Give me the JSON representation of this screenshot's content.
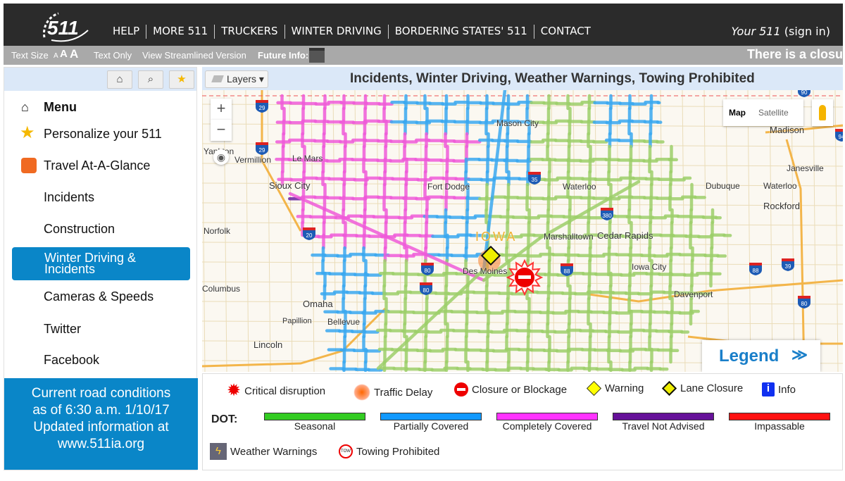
{
  "header": {
    "logo": "511",
    "nav": [
      "HELP",
      "MORE 511",
      "TRUCKERS",
      "WINTER DRIVING",
      "BORDERING STATES' 511",
      "CONTACT"
    ],
    "signin_brand": "Your 511",
    "signin_link": "(sign in)"
  },
  "subbar": {
    "text_size": "Text Size",
    "a_small": "A",
    "a_med": "A",
    "a_large": "A",
    "text_only": "Text Only",
    "streamlined": "View Streamlined Version",
    "future_info": "Future Info:",
    "ticker": "There is a closu"
  },
  "sidebar": {
    "menu": "Menu",
    "items": [
      {
        "label": "Personalize your 511",
        "icon": "star-icon"
      },
      {
        "label": "Travel At-A-Glance",
        "icon": "travel-glance-icon"
      },
      {
        "label": "Incidents"
      },
      {
        "label": "Construction"
      },
      {
        "label": "Winter Driving & Incidents",
        "active": true
      },
      {
        "label": "Cameras & Speeds"
      },
      {
        "label": "Twitter"
      },
      {
        "label": "Facebook"
      }
    ],
    "conditions": [
      "Current road conditions",
      "as of 6:30 a.m. 1/10/17",
      "Updated information at",
      "www.511ia.org"
    ]
  },
  "map": {
    "layers_label": "Layers",
    "title": "Incidents, Winter Driving, Weather Warnings, Towing Prohibited",
    "map_btn": "Map",
    "satellite_btn": "Satellite",
    "legend_btn": "Legend",
    "zoom_in": "+",
    "zoom_out": "−",
    "state_label": "IOWA",
    "cities": [
      "Mason City",
      "Madison",
      "Yankton",
      "Vermillion",
      "Le Mars",
      "Janesville",
      "Sioux City",
      "Fort Dodge",
      "Waterloo",
      "Dubuque",
      "Rockford",
      "Norfolk",
      "Marshalltown",
      "Cedar Rapids",
      "Iowa City",
      "Des Moines",
      "Columbus",
      "Davenport",
      "Omaha",
      "Papillion",
      "Bellevue",
      "Lincoln"
    ],
    "shields": [
      "29",
      "29",
      "35",
      "20",
      "80",
      "380",
      "80",
      "80",
      "88",
      "88",
      "39",
      "80",
      "94",
      "90"
    ],
    "colors": {
      "seasonal": "#9ccf6a",
      "partial": "#3aa8f0",
      "complete": "#ee5ad8",
      "not_advised": "#6a1fa0",
      "impassable": "#f01010"
    }
  },
  "legend": {
    "icons": [
      "Critical disruption",
      "Traffic Delay",
      "Closure or Blockage",
      "Warning",
      "Lane Closure",
      "Info"
    ],
    "dot_label": "DOT:",
    "conditions": [
      {
        "label": "Seasonal",
        "color": "#33cc22"
      },
      {
        "label": "Partially Covered",
        "color": "#1199ff"
      },
      {
        "label": "Completely Covered",
        "color": "#ff33ff"
      },
      {
        "label": "Travel Not Advised",
        "color": "#661199"
      },
      {
        "label": "Impassable",
        "color": "#ff1111"
      }
    ],
    "weather": "Weather Warnings",
    "towing": "Towing Prohibited"
  }
}
